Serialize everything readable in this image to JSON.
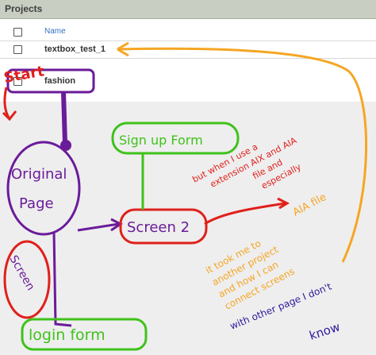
{
  "panel": {
    "title": "Projects"
  },
  "table": {
    "header": {
      "name_label": "Name"
    },
    "rows": [
      {
        "name": "textbox_test_1"
      },
      {
        "name": "fashion"
      }
    ]
  },
  "annotations": {
    "start": "Start",
    "original_page_line1": "Original",
    "original_page_line2": "Page",
    "signup_form": "Sign up Form",
    "screen2": "Screen 2",
    "screen": "Screen",
    "login_form": "login form",
    "red_note_line1": "but when I use a",
    "red_note_line2": "extension AIX and AIA",
    "red_note_line3": "file and",
    "red_note_line4": "especially",
    "red_note_line5": "AIA file",
    "orange_note_line1": "it took me to",
    "orange_note_line2": "another project",
    "orange_note_line3": "and how I can",
    "orange_note_line4": "connect screens",
    "purple_note_line1": "with other page I don't",
    "purple_note_line2": "know"
  },
  "colors": {
    "header_bg": "#c9cec2",
    "canvas_bg": "#eeeeee",
    "purple": "#6a1b9a",
    "red": "#e0201b",
    "green": "#3fc21a",
    "orange": "#f5a623",
    "darkblue": "#2c1a9c"
  }
}
